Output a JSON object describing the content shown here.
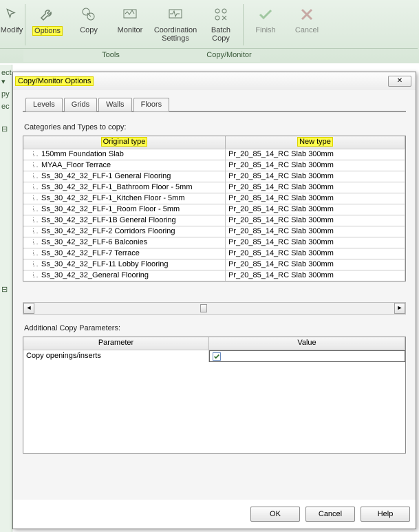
{
  "ribbon": {
    "buttons": [
      {
        "label": "Modify"
      },
      {
        "label": "Options"
      },
      {
        "label": "Copy"
      },
      {
        "label": "Monitor"
      },
      {
        "label": "Coordination\nSettings"
      },
      {
        "label": "Batch\nCopy"
      },
      {
        "label": "Finish"
      },
      {
        "label": "Cancel"
      }
    ],
    "panels": {
      "tools": "Tools",
      "cm": "Copy/Monitor"
    }
  },
  "leftbar": {
    "a": "ect ▾",
    "b": "py",
    "d": "ec"
  },
  "dialog": {
    "title": "Copy/Monitor Options",
    "tabs": [
      "Levels",
      "Grids",
      "Walls",
      "Floors"
    ],
    "active_tab": "Floors",
    "section1": "Categories and Types to copy:",
    "headers": {
      "orig": "Original type",
      "newt": "New type"
    },
    "rows": [
      {
        "orig": "150mm Foundation Slab",
        "newt": "Pr_20_85_14_RC Slab 300mm"
      },
      {
        "orig": "MYAA_Floor Terrace",
        "newt": "Pr_20_85_14_RC Slab 300mm"
      },
      {
        "orig": "Ss_30_42_32_FLF-1 General Flooring",
        "newt": "Pr_20_85_14_RC Slab 300mm"
      },
      {
        "orig": "Ss_30_42_32_FLF-1_Bathroom Floor - 5mm",
        "newt": "Pr_20_85_14_RC Slab 300mm"
      },
      {
        "orig": "Ss_30_42_32_FLF-1_Kitchen Floor - 5mm",
        "newt": "Pr_20_85_14_RC Slab 300mm"
      },
      {
        "orig": "Ss_30_42_32_FLF-1_Room Floor - 5mm",
        "newt": "Pr_20_85_14_RC Slab 300mm"
      },
      {
        "orig": "Ss_30_42_32_FLF-1B General Flooring",
        "newt": "Pr_20_85_14_RC Slab 300mm"
      },
      {
        "orig": "Ss_30_42_32_FLF-2 Corridors Flooring",
        "newt": "Pr_20_85_14_RC Slab 300mm"
      },
      {
        "orig": "Ss_30_42_32_FLF-6 Balconies",
        "newt": "Pr_20_85_14_RC Slab 300mm"
      },
      {
        "orig": "Ss_30_42_32_FLF-7 Terrace",
        "newt": "Pr_20_85_14_RC Slab 300mm"
      },
      {
        "orig": "Ss_30_42_32_FLF-11 Lobby Flooring",
        "newt": "Pr_20_85_14_RC Slab 300mm"
      },
      {
        "orig": "Ss_30_42_32_General Flooring",
        "newt": "Pr_20_85_14_RC Slab 300mm"
      }
    ],
    "section2": "Additional Copy Parameters:",
    "params_headers": {
      "p": "Parameter",
      "v": "Value"
    },
    "param_row": {
      "p": "Copy openings/inserts",
      "checked": true
    },
    "buttons": {
      "ok": "OK",
      "cancel": "Cancel",
      "help": "Help"
    }
  }
}
